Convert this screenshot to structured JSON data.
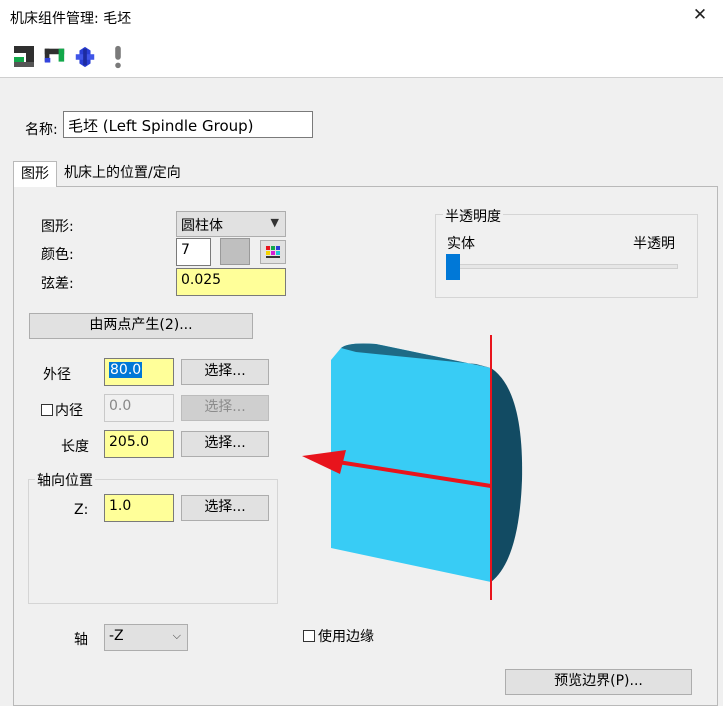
{
  "window": {
    "title": "机床组件管理: 毛坯",
    "close_glyph": "✕"
  },
  "toolbar": {
    "icons": [
      "stock-geometry-icon",
      "fixture-icon",
      "part-icon",
      "warning-icon"
    ]
  },
  "name_label": "名称:",
  "name_value": "毛坯 (Left Spindle Group)",
  "tabs": [
    {
      "label": "图形",
      "active": true
    },
    {
      "label": "机床上的位置/定向",
      "active": false
    }
  ],
  "graphics": {
    "shape_label": "图形:",
    "shape_value": "圆柱体",
    "color_label": "颜色:",
    "color_value": "7",
    "tolerance_label": "弦差:",
    "tolerance_value": "0.025",
    "two_points_button": "由两点产生(2)..."
  },
  "transparency": {
    "title": "半透明度",
    "left_label": "实体",
    "right_label": "半透明",
    "value": 0
  },
  "dims": {
    "outer_label": "外径",
    "outer_value": "80.0",
    "inner_label": "内径",
    "inner_checked": false,
    "inner_value": "0.0",
    "length_label": "长度",
    "length_value": "205.0",
    "select_button": "选择..."
  },
  "axial": {
    "title": "轴向位置",
    "z_label": "Z:",
    "z_value": "1.0"
  },
  "axis": {
    "label": "轴",
    "value": "-Z"
  },
  "use_edges_label": "使用边缘",
  "preview_button": "预览边界(P)...",
  "colors": {
    "accent": "#0078d7",
    "field_yellow": "#ffff99",
    "cylinder_face": "#38ccf5",
    "cylinder_side": "#124b63",
    "arrow_red": "#e8141c"
  }
}
